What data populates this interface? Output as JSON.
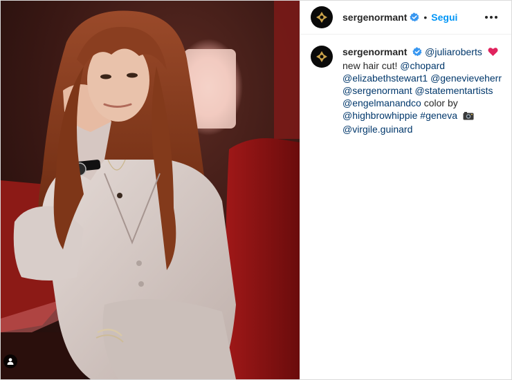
{
  "post": {
    "author": {
      "username": "sergenormant",
      "verified": true,
      "follow_label": "Segui",
      "separator": "•"
    },
    "caption": {
      "username": "sergenormant",
      "mention_1": "@juliaroberts",
      "text_1": "new hair cut!",
      "mention_2": "@chopard",
      "mention_3": "@elizabethstewart1",
      "mention_4": "@genevieveherr",
      "mention_5": "@sergenormant",
      "mention_6": "@statementartists",
      "mention_7": "@engelmanandco",
      "text_2": "color by",
      "mention_8": "@highbrowhippie",
      "hashtag": "#geneva",
      "mention_9": "@virgile.guinard"
    },
    "icons": {
      "verified": "verified-badge-icon",
      "heart": "red-heart-emoji",
      "camera": "camera-emoji",
      "tag": "user-tag-icon",
      "more": "more-options-icon"
    },
    "colors": {
      "link": "#00376b",
      "follow": "#0095f6",
      "verified": "#3897f0",
      "heart": "#e0245e"
    }
  }
}
